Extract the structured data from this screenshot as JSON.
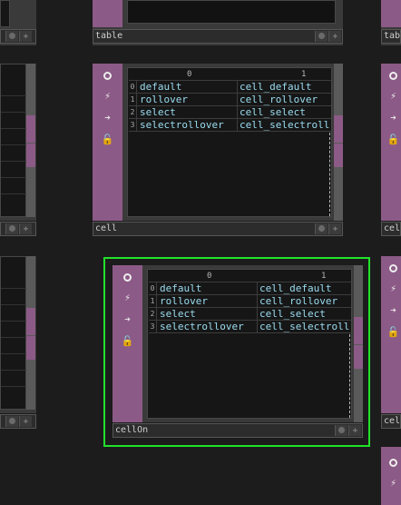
{
  "nodes": {
    "table": {
      "name": "table"
    },
    "cell": {
      "name": "cell",
      "columns": [
        "0",
        "1"
      ],
      "rows": [
        {
          "index": "0",
          "c0": "default",
          "c1": "cell_default"
        },
        {
          "index": "1",
          "c0": "rollover",
          "c1": "cell_rollover"
        },
        {
          "index": "2",
          "c0": "select",
          "c1": "cell_select"
        },
        {
          "index": "3",
          "c0": "selectrollover",
          "c1": "cell_selectroll"
        }
      ]
    },
    "cellOn": {
      "name": "cellOn",
      "columns": [
        "0",
        "1"
      ],
      "rows": [
        {
          "index": "0",
          "c0": "default",
          "c1": "cell_default"
        },
        {
          "index": "1",
          "c0": "rollover",
          "c1": "cell_rollover"
        },
        {
          "index": "2",
          "c0": "select",
          "c1": "cell_select"
        },
        {
          "index": "3",
          "c0": "selectrollover",
          "c1": "cell_selectroll"
        }
      ]
    },
    "right_top": {
      "name": "tabl"
    },
    "right_mid": {
      "name": "cel"
    },
    "right_bot": {
      "name": "cel"
    }
  },
  "colors": {
    "background": "#1c1c1c",
    "dat_sidebar": "#8c5a86",
    "selected_outline": "#22e22a",
    "cell_text": "#9adcf0"
  },
  "icons": [
    "viewer-active-icon",
    "bypass-icon",
    "display-icon",
    "cooking-icon"
  ]
}
